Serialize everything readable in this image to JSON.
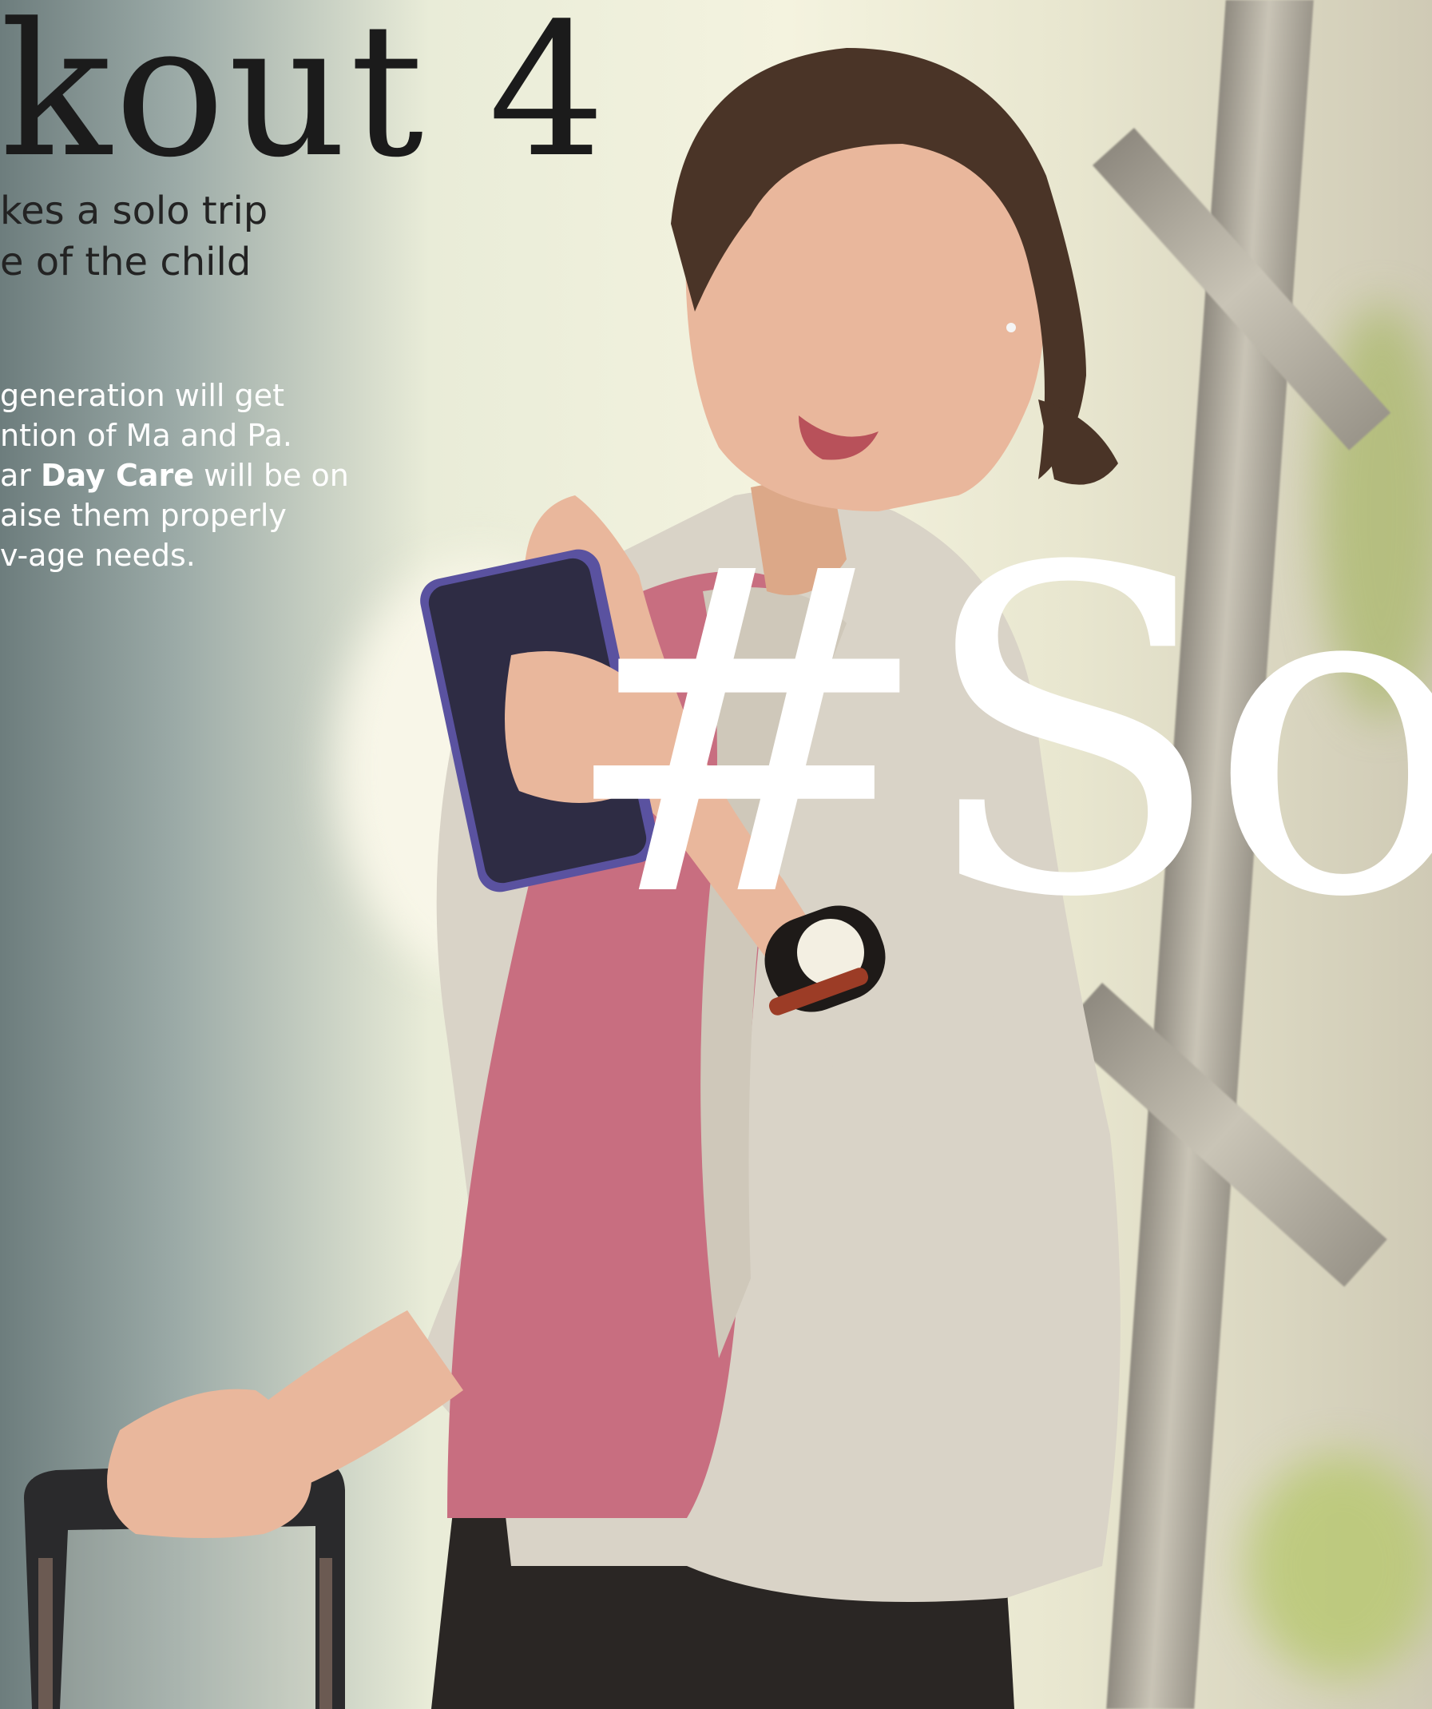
{
  "photo": {
    "subject": "woman-with-phone-and-suitcase",
    "colors": {
      "background_left": "#6d7d7d",
      "background_center": "#f4f3df",
      "blazer": "#d9d3c7",
      "top": "#c86e80",
      "trousers": "#2a2624"
    }
  },
  "text": {
    "title": "kout 4",
    "subtitle_line1": "kes a solo trip",
    "subtitle_line2": "e of the child",
    "body_line1": "generation will get",
    "body_line2": "ntion of Ma and Pa.",
    "body_line3_prefix": "ar ",
    "body_line3_bold": "Day Care",
    "body_line3_suffix": " will be on",
    "body_line4": "aise them properly",
    "body_line5": "v-age needs.",
    "hashtag": "#So"
  }
}
